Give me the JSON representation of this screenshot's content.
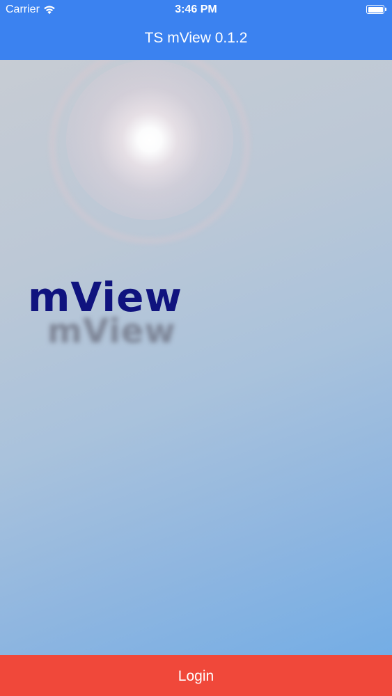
{
  "status_bar": {
    "carrier": "Carrier",
    "time": "3:46 PM",
    "wifi_icon": "wifi-icon",
    "battery_icon": "battery-icon",
    "battery_level_percent": 100
  },
  "nav": {
    "title": "TS mView 0.1.2",
    "background_color": "#3b82f0"
  },
  "splash": {
    "logo_text": "mView",
    "logo_color": "#10137e"
  },
  "footer": {
    "login_label": "Login",
    "button_color": "#f0483a"
  }
}
